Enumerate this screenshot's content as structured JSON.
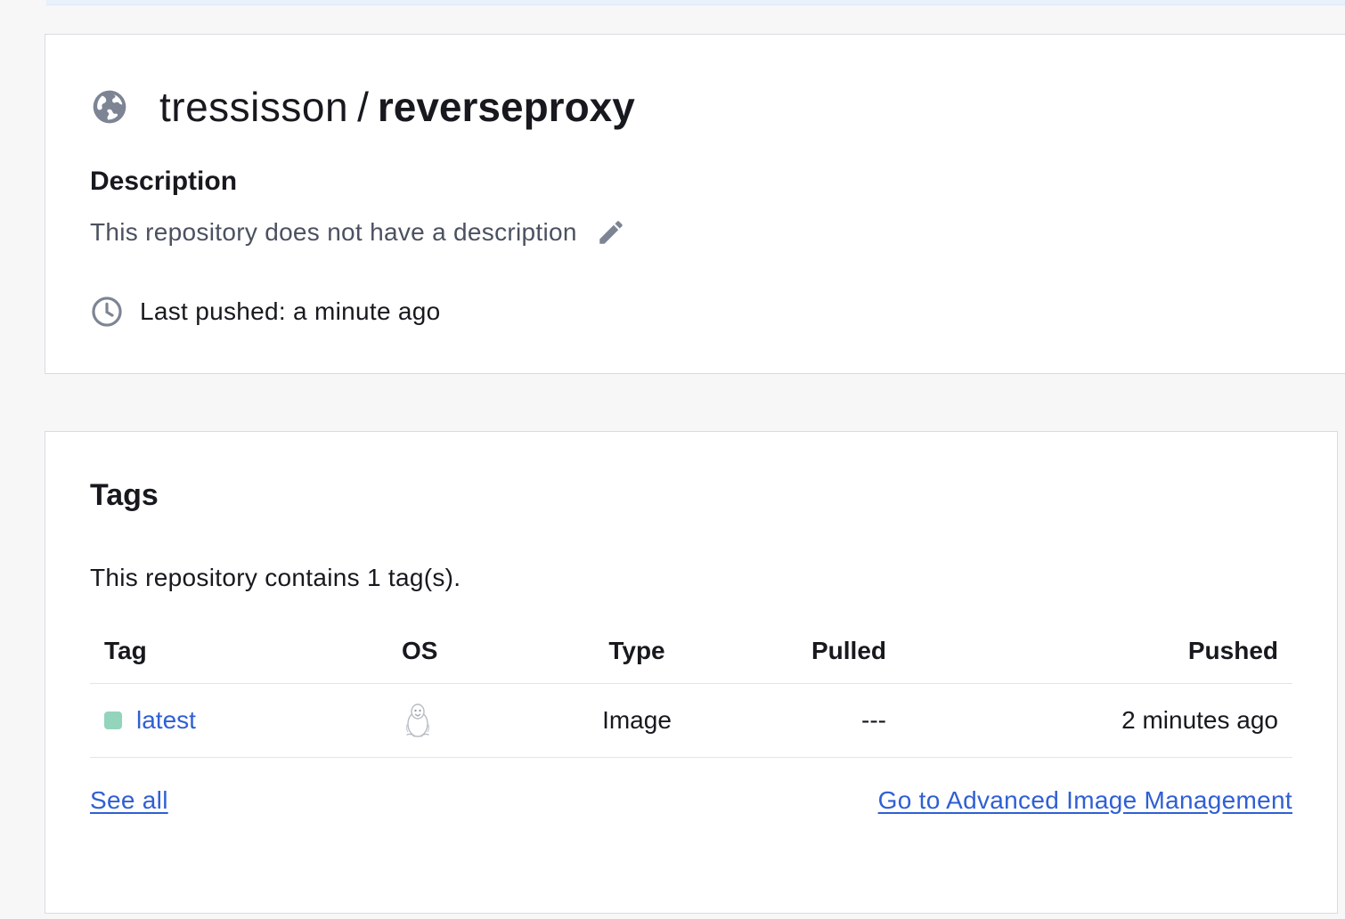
{
  "repo": {
    "namespace": "tressisson",
    "separator": "/",
    "name": "reverseproxy",
    "visibility_icon": "globe-icon"
  },
  "description": {
    "heading": "Description",
    "text": "This repository does not have a description",
    "edit_icon": "pencil-icon"
  },
  "last_pushed": {
    "text": "Last pushed: a minute ago",
    "icon": "clock-icon"
  },
  "tags": {
    "title": "Tags",
    "count_text": "This repository contains 1 tag(s).",
    "columns": {
      "tag": "Tag",
      "os": "OS",
      "type": "Type",
      "pulled": "Pulled",
      "pushed": "Pushed"
    },
    "rows": [
      {
        "tag": "latest",
        "os_icon": "linux-icon",
        "type": "Image",
        "pulled": "---",
        "pushed": "2 minutes ago",
        "status_color": "#93d4bc"
      }
    ],
    "see_all_label": "See all",
    "advanced_label": "Go to Advanced Image Management"
  },
  "colors": {
    "link": "#2f5fd4",
    "icon_gray": "#7d8494",
    "page_bg": "#f7f7f8"
  }
}
